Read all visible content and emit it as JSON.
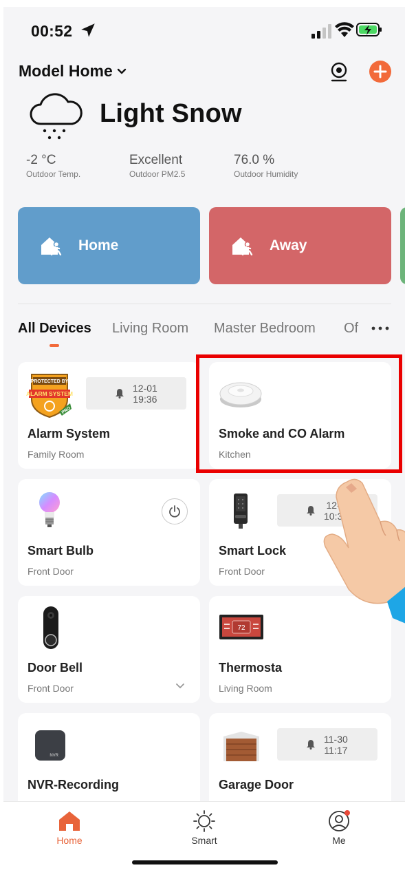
{
  "status_bar": {
    "time": "00:52"
  },
  "header": {
    "home_name": "Model Home"
  },
  "weather": {
    "condition": "Light Snow",
    "stats": [
      {
        "value": "-2 °C",
        "label": "Outdoor Temp."
      },
      {
        "value": "Excellent",
        "label": "Outdoor PM2.5"
      },
      {
        "value": "76.0 %",
        "label": "Outdoor Humidity"
      }
    ]
  },
  "scenes": [
    {
      "label": "Home",
      "color": "#619dcb"
    },
    {
      "label": "Away",
      "color": "#d36668"
    }
  ],
  "tabs": [
    "All Devices",
    "Living Room",
    "Master Bedroom",
    "Of"
  ],
  "devices": [
    {
      "name": "Alarm System",
      "room": "Family Room",
      "badge_date": "12-01",
      "badge_time": "19:36",
      "icon": "alarm-system-icon",
      "logo_text_1": "PROTECTED BY",
      "logo_text_2": "ALARM SYSTEM",
      "logo_text_3": "PRO"
    },
    {
      "name": "Smoke and CO Alarm",
      "room": "Kitchen",
      "icon": "smoke-alarm-icon"
    },
    {
      "name": "Smart Bulb",
      "room": "Front Door",
      "icon": "bulb-icon"
    },
    {
      "name": "Smart Lock",
      "room": "Front Door",
      "badge_date": "12-0",
      "badge_time": "10:38",
      "icon": "lock-icon"
    },
    {
      "name": "Door Bell",
      "room": "Front Door",
      "icon": "doorbell-icon"
    },
    {
      "name": "Thermosta",
      "room": "Living Room",
      "icon": "thermostat-icon",
      "display_value": "72"
    },
    {
      "name": "NVR-Recording",
      "room": "",
      "icon": "nvr-icon",
      "icon_text": "NVR"
    },
    {
      "name": "Garage Door",
      "room": "",
      "badge_date": "11-30",
      "badge_time": "11:17",
      "icon": "garage-icon"
    }
  ],
  "bottom_nav": [
    {
      "label": "Home",
      "active": true
    },
    {
      "label": "Smart",
      "active": false
    },
    {
      "label": "Me",
      "active": false
    }
  ],
  "colors": {
    "accent": "#f26a3a",
    "highlight": "#ea0000"
  }
}
